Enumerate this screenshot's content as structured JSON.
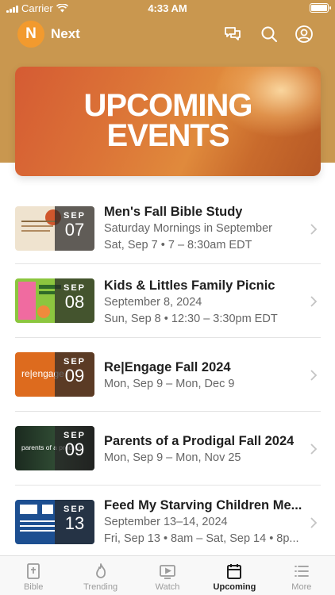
{
  "status_bar": {
    "carrier": "Carrier",
    "time": "4:33 AM"
  },
  "header": {
    "logo_letter": "N",
    "app_name": "Next"
  },
  "hero": {
    "line1": "UPCOMING",
    "line2": "EVENTS"
  },
  "events": [
    {
      "title": "Men's Fall Bible Study",
      "line2": "Saturday Mornings in September",
      "line3": "Sat, Sep 7 • 7 – 8:30am EDT",
      "month": "SEP",
      "day": "07"
    },
    {
      "title": "Kids & Littles Family Picnic",
      "line2": "September 8, 2024",
      "line3": "Sun, Sep 8 • 12:30 – 3:30pm EDT",
      "month": "SEP",
      "day": "08"
    },
    {
      "title": "Re|Engage Fall 2024",
      "line2": "Mon, Sep 9 – Mon, Dec 9",
      "month": "SEP",
      "day": "09",
      "thumb_text": "re|engage"
    },
    {
      "title": "Parents of a Prodigal Fall 2024",
      "line2": "Mon, Sep 9 – Mon, Nov 25",
      "month": "SEP",
      "day": "09",
      "thumb_text": "parents of a prodigal"
    },
    {
      "title": "Feed My Starving Children Me...",
      "line2": "September 13–14, 2024",
      "line3": "Fri, Sep 13 • 8am – Sat, Sep 14 • 8p...",
      "month": "SEP",
      "day": "13"
    }
  ],
  "tabbar": {
    "bible": "Bible",
    "trending": "Trending",
    "watch": "Watch",
    "upcoming": "Upcoming",
    "more": "More"
  },
  "colors": {
    "header_bg": "#c9974f",
    "logo": "#f29a2e",
    "hero": "#dc7437"
  }
}
